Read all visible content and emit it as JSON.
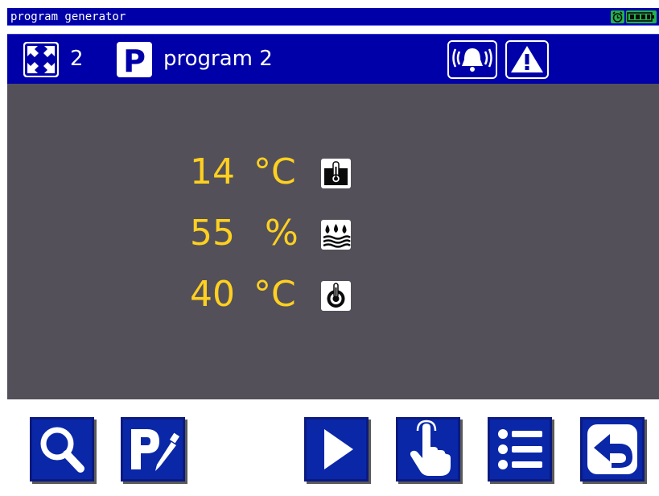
{
  "titlebar": {
    "title": "program generator",
    "icons": [
      "alarm-clock-icon",
      "battery-icon"
    ]
  },
  "header": {
    "count": "2",
    "count_icon": "collapse-arrows-icon",
    "program_icon": "p-icon",
    "program_name": "program 2",
    "alarm_icon": "bell-alarm-icon",
    "warning_icon": "warning-triangle-icon"
  },
  "readings": [
    {
      "value": "14",
      "unit": "°C",
      "icon": "tank-temperature-icon"
    },
    {
      "value": "55",
      "unit": "%",
      "icon": "humidity-icon"
    },
    {
      "value": "40",
      "unit": "°C",
      "icon": "probe-temperature-icon"
    }
  ],
  "toolbar": {
    "buttons": [
      "search",
      "edit-program",
      "play",
      "touch",
      "list",
      "back"
    ]
  },
  "colors": {
    "bar_blue": "#0000a8",
    "panel_gray": "#535059",
    "value_yellow": "#ffd020",
    "button_blue": "#0a27a8",
    "status_green": "#22b14c"
  }
}
